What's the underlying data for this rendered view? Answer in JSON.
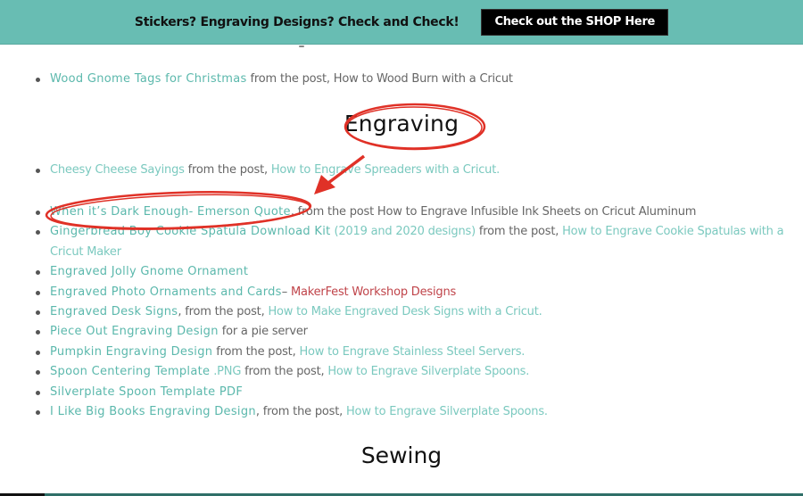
{
  "banner": {
    "text": "Stickers? Engraving Designs? Check and Check!",
    "button_label": "Check out the SHOP Here",
    "background": "#68bdb3"
  },
  "woodburn_item": {
    "link": "Wood Gnome Tags for Christmas",
    "text": " from the post, How to Wood Burn with a Cricut"
  },
  "section_engraving": {
    "heading": "Engraving",
    "cheesy": {
      "link": "Cheesy Cheese Sayings",
      "text": " from the post, ",
      "post_link": "How to Engrave Spreaders with a Cricut."
    },
    "items": [
      {
        "link": "When it’s Dark Enough- Emerson Quote",
        "text": ", from the post How to Engrave Infusible Ink Sheets on Cricut Aluminum"
      },
      {
        "link": "Gingerbread Boy Cookie Spatula Download Kit",
        "link2": " (2019 and 2020 designs)",
        "text": " from the post, ",
        "post_link": "How to Engrave Cookie Spatulas with a Cricut Maker"
      },
      {
        "link": "Engraved Jolly Gnome Ornament"
      },
      {
        "link": "Engraved Photo Ornaments and Cards",
        "text": "– ",
        "red_link": "MakerFest Workshop Designs"
      },
      {
        "link": "Engraved Desk Signs",
        "text": ", from the post, ",
        "post_link": "How to Make Engraved Desk Signs with a Cricut."
      },
      {
        "link": "Piece Out Engraving Design",
        "text": " for a pie server"
      },
      {
        "link": "Pumpkin Engraving Design",
        "text": " from the post, ",
        "post_link": "How to Engrave Stainless Steel Servers."
      },
      {
        "link": "Spoon Centering Template",
        "link2": " .PNG",
        "text": " from the post, ",
        "post_link": "How to Engrave Silverplate Spoons."
      },
      {
        "link": "Silverplate Spoon Template PDF"
      },
      {
        "link": "I Like Big Books Engraving Design",
        "text": ", from the post, ",
        "post_link": "How to Engrave Silverplate Spoons."
      }
    ]
  },
  "section_sewing": {
    "heading": "Sewing"
  },
  "annotation": {
    "color": "#e03127"
  }
}
